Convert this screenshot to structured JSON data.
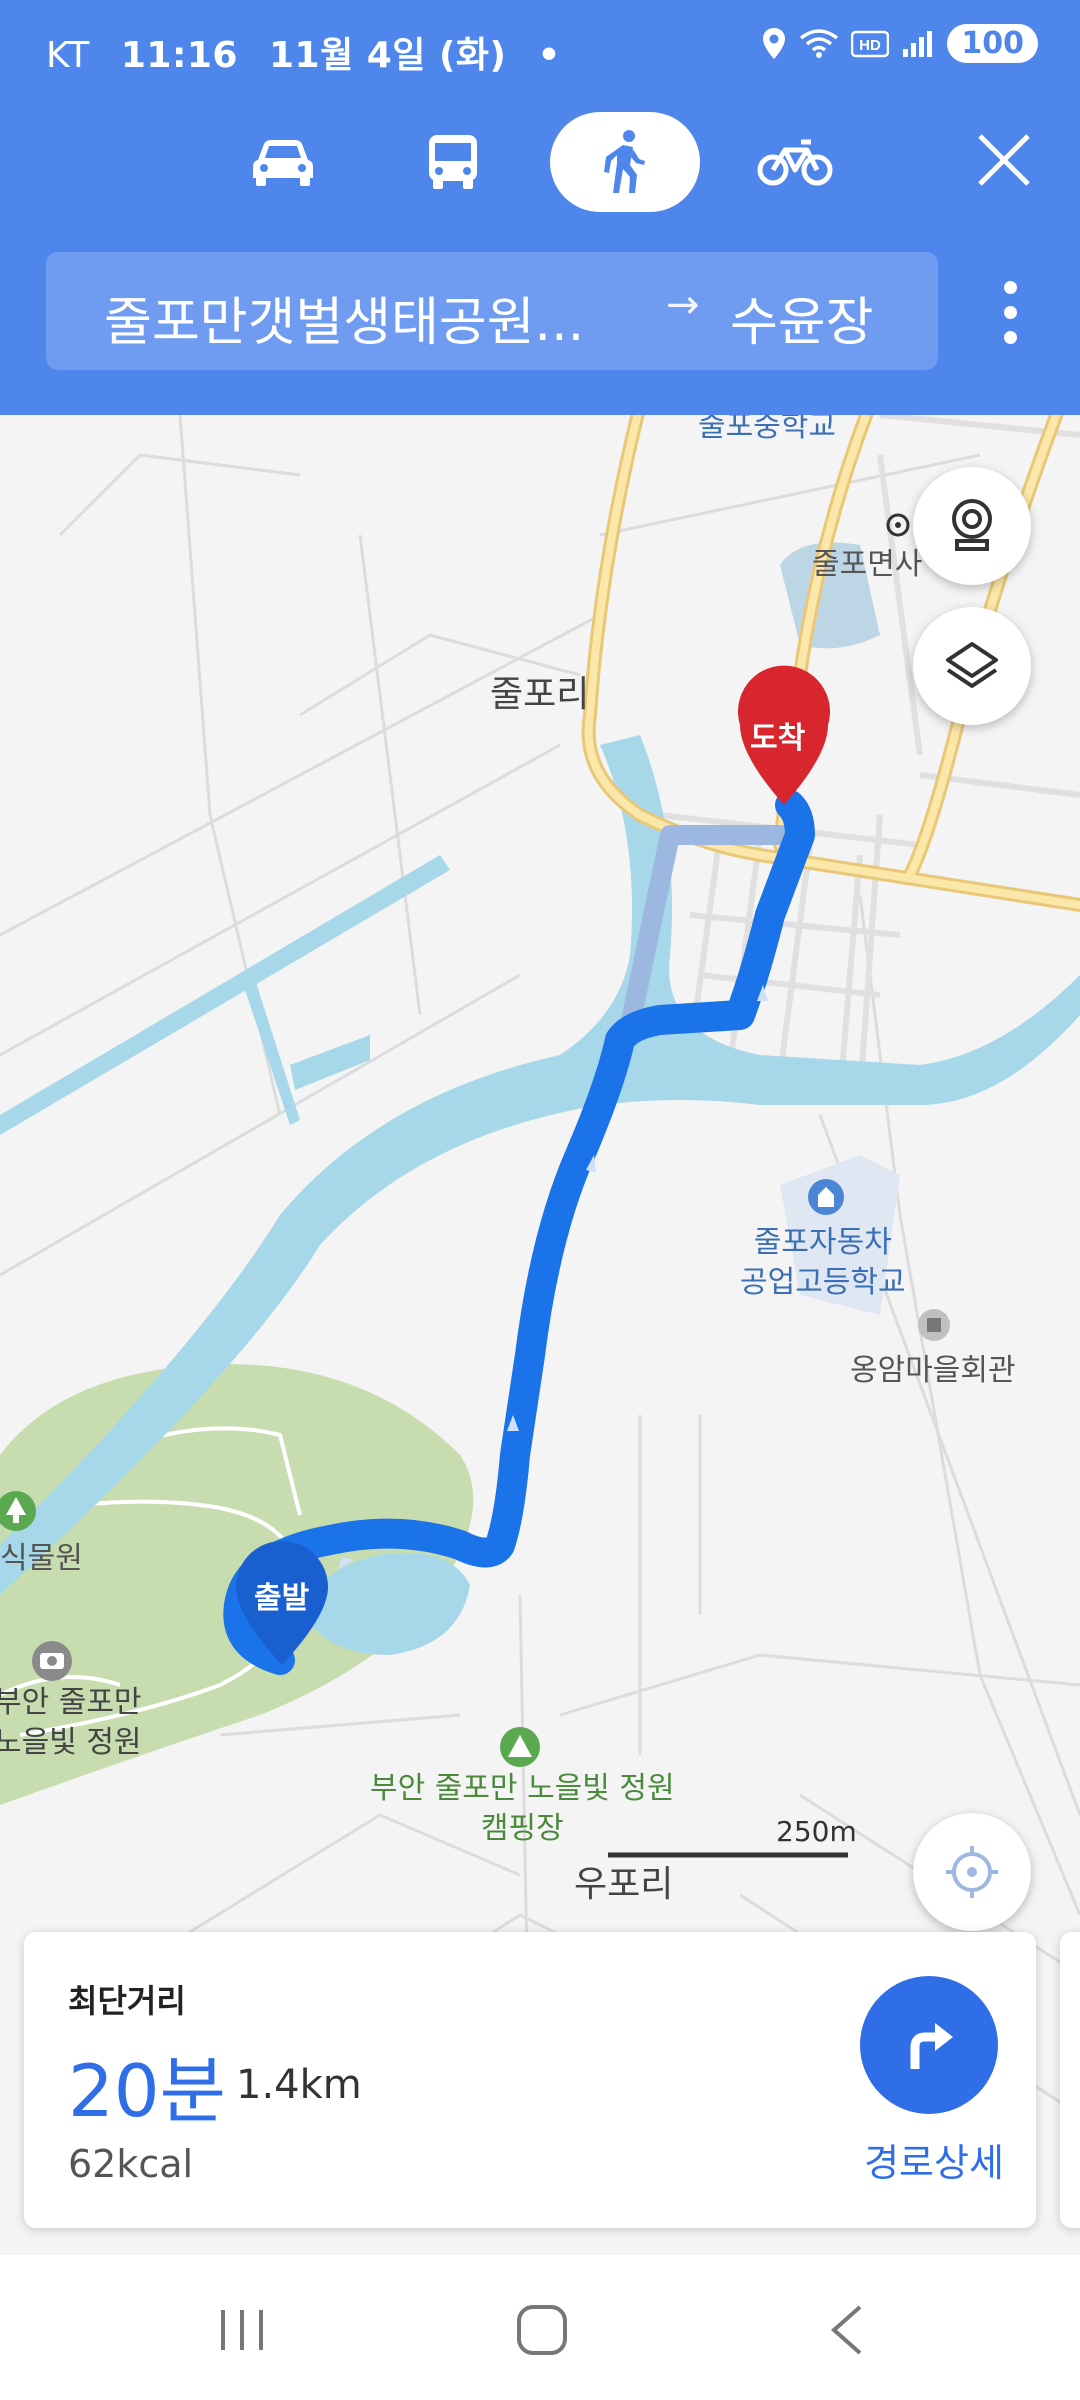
{
  "status_bar": {
    "carrier": "KT",
    "time": "11:16",
    "date": "11월 4일 (화)",
    "dot": "•",
    "battery": "100"
  },
  "header": {
    "modes": [
      {
        "name": "car",
        "icon": "car-icon"
      },
      {
        "name": "bus",
        "icon": "bus-icon"
      },
      {
        "name": "walk",
        "icon": "walk-icon",
        "active": true
      },
      {
        "name": "bike",
        "icon": "bike-icon"
      }
    ],
    "origin": "줄포만갯벌생태공원...",
    "arrow": "→",
    "destination": "수윤장"
  },
  "map": {
    "labels": {
      "juldong_school": "줄포중학교",
      "julpo_office": "줄포면사",
      "julpo_ri": "줄포리",
      "auto_school_line1": "줄포자동차",
      "auto_school_line2": "공업고등학교",
      "ongam_hall": "옹암마을회관",
      "plant_garden": "식물원",
      "garden_line1": "부안 줄포만",
      "garden_line2": "노을빛 정원",
      "camping_line1": "부안 줄포만 노을빛 정원",
      "camping_line2": "캠핑장",
      "upo_ri": "우포리",
      "scale": "250m"
    },
    "start_marker": "출발",
    "end_marker": "도착",
    "colors": {
      "route": "#1a73e8",
      "alt_route": "#9db8e0",
      "water": "#a6d8ea",
      "park": "#c7ddb0",
      "main_road": "#f7d98a",
      "end_marker": "#d8262e",
      "start_marker": "#1a5fd0"
    }
  },
  "route_card": {
    "type": "최단거리",
    "time": "20분",
    "distance": "1.4km",
    "kcal": "62kcal",
    "detail_label": "경로상세"
  }
}
